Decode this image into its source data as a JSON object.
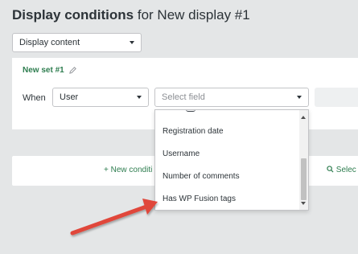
{
  "header": {
    "title_bold": "Display conditions",
    "title_rest": "for New display #1"
  },
  "content_select": {
    "value": "Display content"
  },
  "condition_set": {
    "name": "New set #1"
  },
  "condition_row": {
    "when_label": "When",
    "subject_value": "User",
    "field_placeholder": "Select field"
  },
  "field_dropdown": {
    "options": [
      "Registration date",
      "Username",
      "Number of comments",
      "Has WP Fusion tags"
    ]
  },
  "actions": {
    "new_condition": "New conditi",
    "select": "Selec"
  },
  "colors": {
    "background": "#e4e6e7",
    "accent_green": "#2e7d4f",
    "arrow_red": "#e0463a"
  },
  "icons": [
    "pencil-icon",
    "plus-icon",
    "search-icon",
    "chevron-down-icon",
    "scroll-up-icon",
    "scroll-down-icon",
    "arrow-annotation"
  ]
}
